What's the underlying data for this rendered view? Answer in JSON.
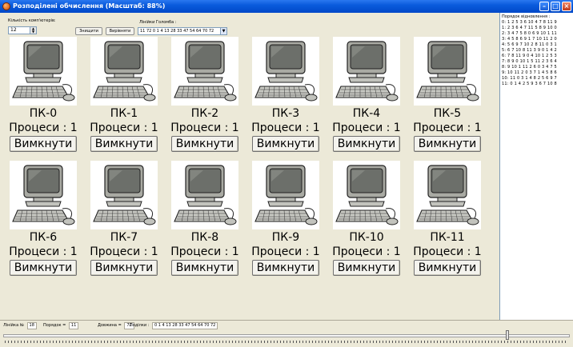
{
  "window": {
    "title": "Розподілені обчислення (Масштаб: 88%)"
  },
  "toolbar": {
    "count_label": "Кількість комп'ютерів:",
    "count_value": "12",
    "destroy_label": "Знищити",
    "align_label": "Вирівняти",
    "lines_label": "Лінійки Голомба :",
    "lines_value": "11 72 0 1 4 13 28 33 47 54 64 70 72"
  },
  "computers": [
    {
      "name": "ПК-0",
      "procs": "Процеси : 1",
      "off": "Вимкнути"
    },
    {
      "name": "ПК-1",
      "procs": "Процеси : 1",
      "off": "Вимкнути"
    },
    {
      "name": "ПК-2",
      "procs": "Процеси : 1",
      "off": "Вимкнути"
    },
    {
      "name": "ПК-3",
      "procs": "Процеси : 1",
      "off": "Вимкнути"
    },
    {
      "name": "ПК-4",
      "procs": "Процеси : 1",
      "off": "Вимкнути"
    },
    {
      "name": "ПК-5",
      "procs": "Процеси : 1",
      "off": "Вимкнути"
    },
    {
      "name": "ПК-6",
      "procs": "Процеси : 1",
      "off": "Вимкнути"
    },
    {
      "name": "ПК-7",
      "procs": "Процеси : 1",
      "off": "Вимкнути"
    },
    {
      "name": "ПК-8",
      "procs": "Процеси : 1",
      "off": "Вимкнути"
    },
    {
      "name": "ПК-9",
      "procs": "Процеси : 1",
      "off": "Вимкнути"
    },
    {
      "name": "ПК-10",
      "procs": "Процеси : 1",
      "off": "Вимкнути"
    },
    {
      "name": "ПК-11",
      "procs": "Процеси : 1",
      "off": "Вимкнути"
    }
  ],
  "recovery": {
    "title": "Порядок відновлення :",
    "lines": [
      "0: 1 2 5 3 6 10 4 7 8 11 9",
      "1: 2 3 6 4 7 11 5 8 9 10 0",
      "2: 3 4 7 5 8 0 6 9 10 1 11",
      "3: 4 5 8 6 9 1 7 10 11 2 0",
      "4: 5 6 9 7 10 2 8 11 0 3 1",
      "5: 6 7 10 8 11 3 9 0 1 4 2",
      "6: 7 8 11 9 0 4 10 1 2 5 3",
      "7: 8 9 0 10 1 5 11 2 3 6 4",
      "8: 9 10 1 11 2 6 0 3 4 7 5",
      "9: 10 11 2 0 3 7 1 4 5 8 6",
      "10: 11 0 3 1 4 8 2 5 6 9 7",
      "11: 0 1 4 2 5 9 3 6 7 10 8"
    ]
  },
  "status": {
    "line_label": "Лінійка №",
    "line_value": "18",
    "order_label": "Порядок =",
    "order_value": "11",
    "length_label": "Довжина =",
    "length_value": "72",
    "marks_label": "Поділки :",
    "marks_value": "0 1 4 13 28 33 47 54 64 70 72"
  },
  "slider": {
    "fraction": 0.89
  },
  "icons": {
    "app": "app-icon",
    "minimize": "minimize-icon",
    "maximize": "maximize-icon",
    "close": "close-icon",
    "computer": "computer-icon"
  }
}
